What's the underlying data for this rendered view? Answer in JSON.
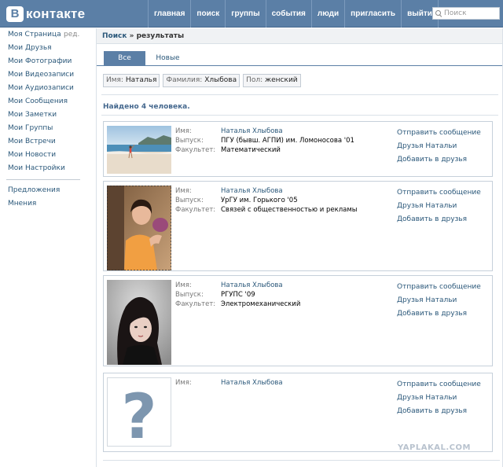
{
  "header": {
    "logo_letter": "В",
    "logo_text": "контакте",
    "nav": [
      "главная",
      "поиск",
      "группы",
      "события",
      "люди",
      "пригласить",
      "выйти"
    ],
    "search_placeholder": "Поиск"
  },
  "sidebar": {
    "edit_label": "ред.",
    "items": [
      "Моя Страница",
      "Мои Друзья",
      "Мои Фотографии",
      "Мои Видеозаписи",
      "Мои Аудиозаписи",
      "Мои Сообщения",
      "Мои Заметки",
      "Мои Группы",
      "Мои Встречи",
      "Мои Новости",
      "Мои Настройки"
    ],
    "extra_items": [
      "Предложения",
      "Мнения"
    ]
  },
  "breadcrumb": {
    "link": "Поиск",
    "separator": " » ",
    "current": "результаты"
  },
  "tabs": {
    "all": "Все",
    "new": "Новые"
  },
  "filters": [
    {
      "key": "Имя:",
      "value": "Наталья"
    },
    {
      "key": "Фамилия:",
      "value": "Хлыбова"
    },
    {
      "key": "Пол:",
      "value": "женский"
    }
  ],
  "found_text": "Найдено 4 человека.",
  "labels": {
    "name": "Имя:",
    "graduation": "Выпуск:",
    "faculty": "Факультет:"
  },
  "actions": {
    "send_message": "Отправить сообщение",
    "friends": "Друзья Натальи",
    "add_friend": "Добавить в друзья"
  },
  "results": [
    {
      "name": "Наталья Хлыбова",
      "graduation": "ПГУ (бывш. АГПИ) им. Ломоносова '01",
      "faculty": "Математический"
    },
    {
      "name": "Наталья Хлыбова",
      "graduation": "УрГУ им. Горького '05",
      "faculty": "Связей с общественностью и рекламы"
    },
    {
      "name": "Наталья Хлыбова",
      "graduation": "РГУПС '09",
      "faculty": "Электромеханический"
    },
    {
      "name": "Наталья Хлыбова"
    }
  ],
  "watermark": "YAPLAKAL.COM",
  "colors": {
    "header": "#5b7fa6",
    "link": "#2b587a",
    "found": "#45688e"
  }
}
